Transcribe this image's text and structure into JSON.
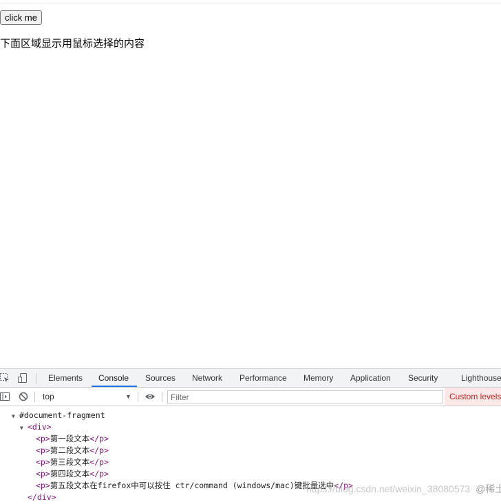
{
  "page": {
    "button_label": "click me",
    "hint": "下面区域显示用鼠标选择的内容"
  },
  "devtools": {
    "tabs": [
      {
        "label": "Elements",
        "active": false
      },
      {
        "label": "Console",
        "active": true
      },
      {
        "label": "Sources",
        "active": false
      },
      {
        "label": "Network",
        "active": false
      },
      {
        "label": "Performance",
        "active": false
      },
      {
        "label": "Memory",
        "active": false
      },
      {
        "label": "Application",
        "active": false
      },
      {
        "label": "Security",
        "active": false
      },
      {
        "label": "Lighthouse",
        "active": false
      }
    ],
    "accent": "#1a73e8",
    "toolbar": {
      "context": "top",
      "filter_placeholder": "Filter",
      "levels": "Custom levels"
    },
    "console": {
      "fragment": "#document-fragment",
      "div_open": "<div>",
      "div_close": "</div>",
      "p_open": "<p>",
      "p_close": "</p>",
      "paragraphs": [
        "第一段文本",
        "第二段文本",
        "第三段文本",
        "第四段文本",
        "第五段文本在firefox中可以按住 ctr/command (windows/mac)键批量选中"
      ]
    }
  },
  "watermark": {
    "url": "https://blog.csdn.net/weixin_38080573",
    "brand": "@稀土掘金技术社区"
  }
}
